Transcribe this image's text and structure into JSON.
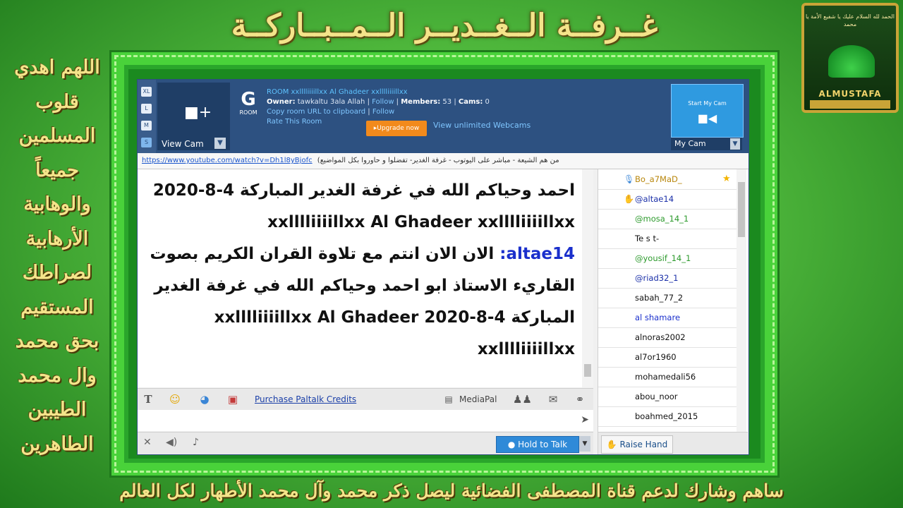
{
  "banner": {
    "title": "غــرفــة الــغــديــر الــمــبــاركــة",
    "side_lines": [
      "اللهم اهدي",
      "قلوب",
      "المسلمين",
      "جميعاً",
      "والوهابية",
      "الأرهابية",
      "لصراطك",
      "المستقيم",
      "بحق محمد",
      "وال محمد",
      "الطيبين",
      "الطاهرين"
    ],
    "bottom": "ساهم وشارك لدعم قناة المصطفى الفضائية ليصل ذكر محمد وآل محمد الأطهار لكل العالم",
    "logo_text": "الحمد لله  السلام عليك يا شفيع الأمة  يا محمد",
    "logo_name": "ALMUSTAFA"
  },
  "app": {
    "size_buttons": [
      "XL",
      "L",
      "M",
      "S"
    ],
    "view_cam_label": "View Cam",
    "room_badge_letter": "G",
    "room_badge_label": "ROOM",
    "room_title": "ROOM xxlllliiiillxx Al Ghadeer xxlllliiiillxx",
    "owner_label": "Owner:",
    "owner_value": "tawkaltu 3ala Allah",
    "follow": "Follow",
    "members_label": "Members:",
    "members_value": "53",
    "cams_label": "Cams:",
    "cams_value": "0",
    "copy_url": "Copy room URL to clipboard",
    "rate_room": "Rate This Room",
    "upgrade": "▸Upgrade now",
    "unlimited": "View unlimited Webcams",
    "start_cam": "Start My Cam",
    "my_cam": "My Cam",
    "link_url": "https://www.youtube.com/watch?v=Dh1l8yBjofc",
    "link_desc": "(من هم الشيعة - مباشر على اليوتوب - غرفة الغدير- تفضلوا و حاوروا بكل المواضيع",
    "messages": {
      "line1": "احمد وحياكم الله في غرفة الغدير المباركة 4-8-2020 xxlllliiiillxx Al Ghadeer xxlllliiiillxx",
      "nick": "altae14:",
      "line2": "الان الان انتم مع تلاوة القران الكريم بصوت القاريء الاستاذ ابو احمد وحياكم الله في غرفة الغدير المباركة 4-8-2020 xxlllliiiillxx Al Ghadeer xxlllliiiillxx"
    },
    "toolbar": {
      "purchase": "Purchase Paltalk Credits",
      "mediapal": "MediaPal"
    },
    "hold_to_talk": "Hold to Talk",
    "raise_hand": "Raise Hand",
    "users": [
      {
        "name": "Bo_a7MaD_",
        "color": "#b8860b",
        "icon": "mic-icon",
        "star": true
      },
      {
        "name": "@altae14",
        "color": "#1a2fa8",
        "icon": "hand-icon",
        "star": false
      },
      {
        "name": "@mosa_14_1",
        "color": "#2c9a2c",
        "icon": "",
        "star": false
      },
      {
        "name": "Te s t-",
        "color": "#111111",
        "icon": "",
        "star": false
      },
      {
        "name": "@yousif_14_1",
        "color": "#2c9a2c",
        "icon": "",
        "star": false
      },
      {
        "name": "@riad32_1",
        "color": "#1a2fa8",
        "icon": "",
        "star": false
      },
      {
        "name": "sabah_77_2",
        "color": "#111111",
        "icon": "",
        "star": false
      },
      {
        "name": "al shamare",
        "color": "#1a2fcc",
        "icon": "",
        "star": false
      },
      {
        "name": "alnoras2002",
        "color": "#111111",
        "icon": "",
        "star": false
      },
      {
        "name": "al7or1960",
        "color": "#111111",
        "icon": "",
        "star": false
      },
      {
        "name": "mohamedali56",
        "color": "#111111",
        "icon": "",
        "star": false
      },
      {
        "name": "abou_noor",
        "color": "#111111",
        "icon": "",
        "star": false
      },
      {
        "name": "boahmed_2015",
        "color": "#111111",
        "icon": "",
        "star": false
      }
    ]
  }
}
